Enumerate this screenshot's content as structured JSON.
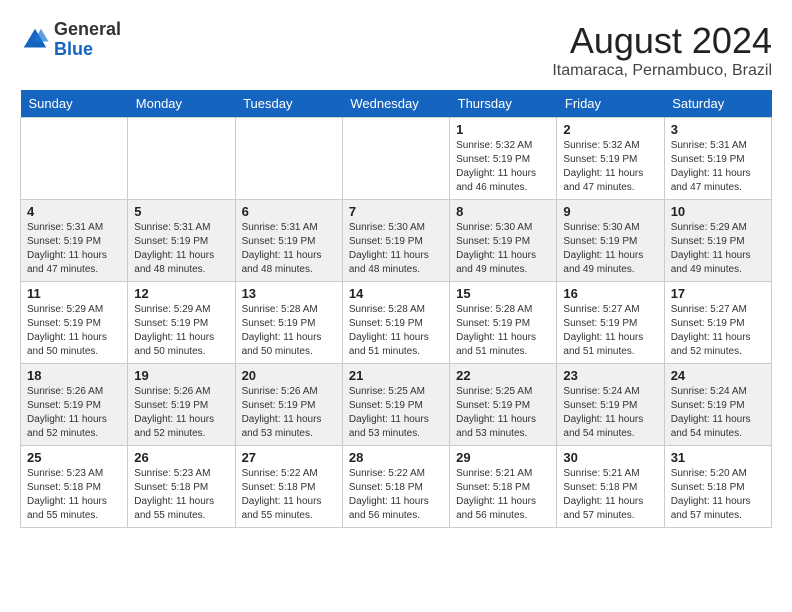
{
  "header": {
    "logo_general": "General",
    "logo_blue": "Blue",
    "month_year": "August 2024",
    "location": "Itamaraca, Pernambuco, Brazil"
  },
  "weekdays": [
    "Sunday",
    "Monday",
    "Tuesday",
    "Wednesday",
    "Thursday",
    "Friday",
    "Saturday"
  ],
  "weeks": [
    [
      {
        "day": "",
        "sunrise": "",
        "sunset": "",
        "daylight": ""
      },
      {
        "day": "",
        "sunrise": "",
        "sunset": "",
        "daylight": ""
      },
      {
        "day": "",
        "sunrise": "",
        "sunset": "",
        "daylight": ""
      },
      {
        "day": "",
        "sunrise": "",
        "sunset": "",
        "daylight": ""
      },
      {
        "day": "1",
        "sunrise": "Sunrise: 5:32 AM",
        "sunset": "Sunset: 5:19 PM",
        "daylight": "Daylight: 11 hours and 46 minutes."
      },
      {
        "day": "2",
        "sunrise": "Sunrise: 5:32 AM",
        "sunset": "Sunset: 5:19 PM",
        "daylight": "Daylight: 11 hours and 47 minutes."
      },
      {
        "day": "3",
        "sunrise": "Sunrise: 5:31 AM",
        "sunset": "Sunset: 5:19 PM",
        "daylight": "Daylight: 11 hours and 47 minutes."
      }
    ],
    [
      {
        "day": "4",
        "sunrise": "Sunrise: 5:31 AM",
        "sunset": "Sunset: 5:19 PM",
        "daylight": "Daylight: 11 hours and 47 minutes."
      },
      {
        "day": "5",
        "sunrise": "Sunrise: 5:31 AM",
        "sunset": "Sunset: 5:19 PM",
        "daylight": "Daylight: 11 hours and 48 minutes."
      },
      {
        "day": "6",
        "sunrise": "Sunrise: 5:31 AM",
        "sunset": "Sunset: 5:19 PM",
        "daylight": "Daylight: 11 hours and 48 minutes."
      },
      {
        "day": "7",
        "sunrise": "Sunrise: 5:30 AM",
        "sunset": "Sunset: 5:19 PM",
        "daylight": "Daylight: 11 hours and 48 minutes."
      },
      {
        "day": "8",
        "sunrise": "Sunrise: 5:30 AM",
        "sunset": "Sunset: 5:19 PM",
        "daylight": "Daylight: 11 hours and 49 minutes."
      },
      {
        "day": "9",
        "sunrise": "Sunrise: 5:30 AM",
        "sunset": "Sunset: 5:19 PM",
        "daylight": "Daylight: 11 hours and 49 minutes."
      },
      {
        "day": "10",
        "sunrise": "Sunrise: 5:29 AM",
        "sunset": "Sunset: 5:19 PM",
        "daylight": "Daylight: 11 hours and 49 minutes."
      }
    ],
    [
      {
        "day": "11",
        "sunrise": "Sunrise: 5:29 AM",
        "sunset": "Sunset: 5:19 PM",
        "daylight": "Daylight: 11 hours and 50 minutes."
      },
      {
        "day": "12",
        "sunrise": "Sunrise: 5:29 AM",
        "sunset": "Sunset: 5:19 PM",
        "daylight": "Daylight: 11 hours and 50 minutes."
      },
      {
        "day": "13",
        "sunrise": "Sunrise: 5:28 AM",
        "sunset": "Sunset: 5:19 PM",
        "daylight": "Daylight: 11 hours and 50 minutes."
      },
      {
        "day": "14",
        "sunrise": "Sunrise: 5:28 AM",
        "sunset": "Sunset: 5:19 PM",
        "daylight": "Daylight: 11 hours and 51 minutes."
      },
      {
        "day": "15",
        "sunrise": "Sunrise: 5:28 AM",
        "sunset": "Sunset: 5:19 PM",
        "daylight": "Daylight: 11 hours and 51 minutes."
      },
      {
        "day": "16",
        "sunrise": "Sunrise: 5:27 AM",
        "sunset": "Sunset: 5:19 PM",
        "daylight": "Daylight: 11 hours and 51 minutes."
      },
      {
        "day": "17",
        "sunrise": "Sunrise: 5:27 AM",
        "sunset": "Sunset: 5:19 PM",
        "daylight": "Daylight: 11 hours and 52 minutes."
      }
    ],
    [
      {
        "day": "18",
        "sunrise": "Sunrise: 5:26 AM",
        "sunset": "Sunset: 5:19 PM",
        "daylight": "Daylight: 11 hours and 52 minutes."
      },
      {
        "day": "19",
        "sunrise": "Sunrise: 5:26 AM",
        "sunset": "Sunset: 5:19 PM",
        "daylight": "Daylight: 11 hours and 52 minutes."
      },
      {
        "day": "20",
        "sunrise": "Sunrise: 5:26 AM",
        "sunset": "Sunset: 5:19 PM",
        "daylight": "Daylight: 11 hours and 53 minutes."
      },
      {
        "day": "21",
        "sunrise": "Sunrise: 5:25 AM",
        "sunset": "Sunset: 5:19 PM",
        "daylight": "Daylight: 11 hours and 53 minutes."
      },
      {
        "day": "22",
        "sunrise": "Sunrise: 5:25 AM",
        "sunset": "Sunset: 5:19 PM",
        "daylight": "Daylight: 11 hours and 53 minutes."
      },
      {
        "day": "23",
        "sunrise": "Sunrise: 5:24 AM",
        "sunset": "Sunset: 5:19 PM",
        "daylight": "Daylight: 11 hours and 54 minutes."
      },
      {
        "day": "24",
        "sunrise": "Sunrise: 5:24 AM",
        "sunset": "Sunset: 5:19 PM",
        "daylight": "Daylight: 11 hours and 54 minutes."
      }
    ],
    [
      {
        "day": "25",
        "sunrise": "Sunrise: 5:23 AM",
        "sunset": "Sunset: 5:18 PM",
        "daylight": "Daylight: 11 hours and 55 minutes."
      },
      {
        "day": "26",
        "sunrise": "Sunrise: 5:23 AM",
        "sunset": "Sunset: 5:18 PM",
        "daylight": "Daylight: 11 hours and 55 minutes."
      },
      {
        "day": "27",
        "sunrise": "Sunrise: 5:22 AM",
        "sunset": "Sunset: 5:18 PM",
        "daylight": "Daylight: 11 hours and 55 minutes."
      },
      {
        "day": "28",
        "sunrise": "Sunrise: 5:22 AM",
        "sunset": "Sunset: 5:18 PM",
        "daylight": "Daylight: 11 hours and 56 minutes."
      },
      {
        "day": "29",
        "sunrise": "Sunrise: 5:21 AM",
        "sunset": "Sunset: 5:18 PM",
        "daylight": "Daylight: 11 hours and 56 minutes."
      },
      {
        "day": "30",
        "sunrise": "Sunrise: 5:21 AM",
        "sunset": "Sunset: 5:18 PM",
        "daylight": "Daylight: 11 hours and 57 minutes."
      },
      {
        "day": "31",
        "sunrise": "Sunrise: 5:20 AM",
        "sunset": "Sunset: 5:18 PM",
        "daylight": "Daylight: 11 hours and 57 minutes."
      }
    ]
  ]
}
